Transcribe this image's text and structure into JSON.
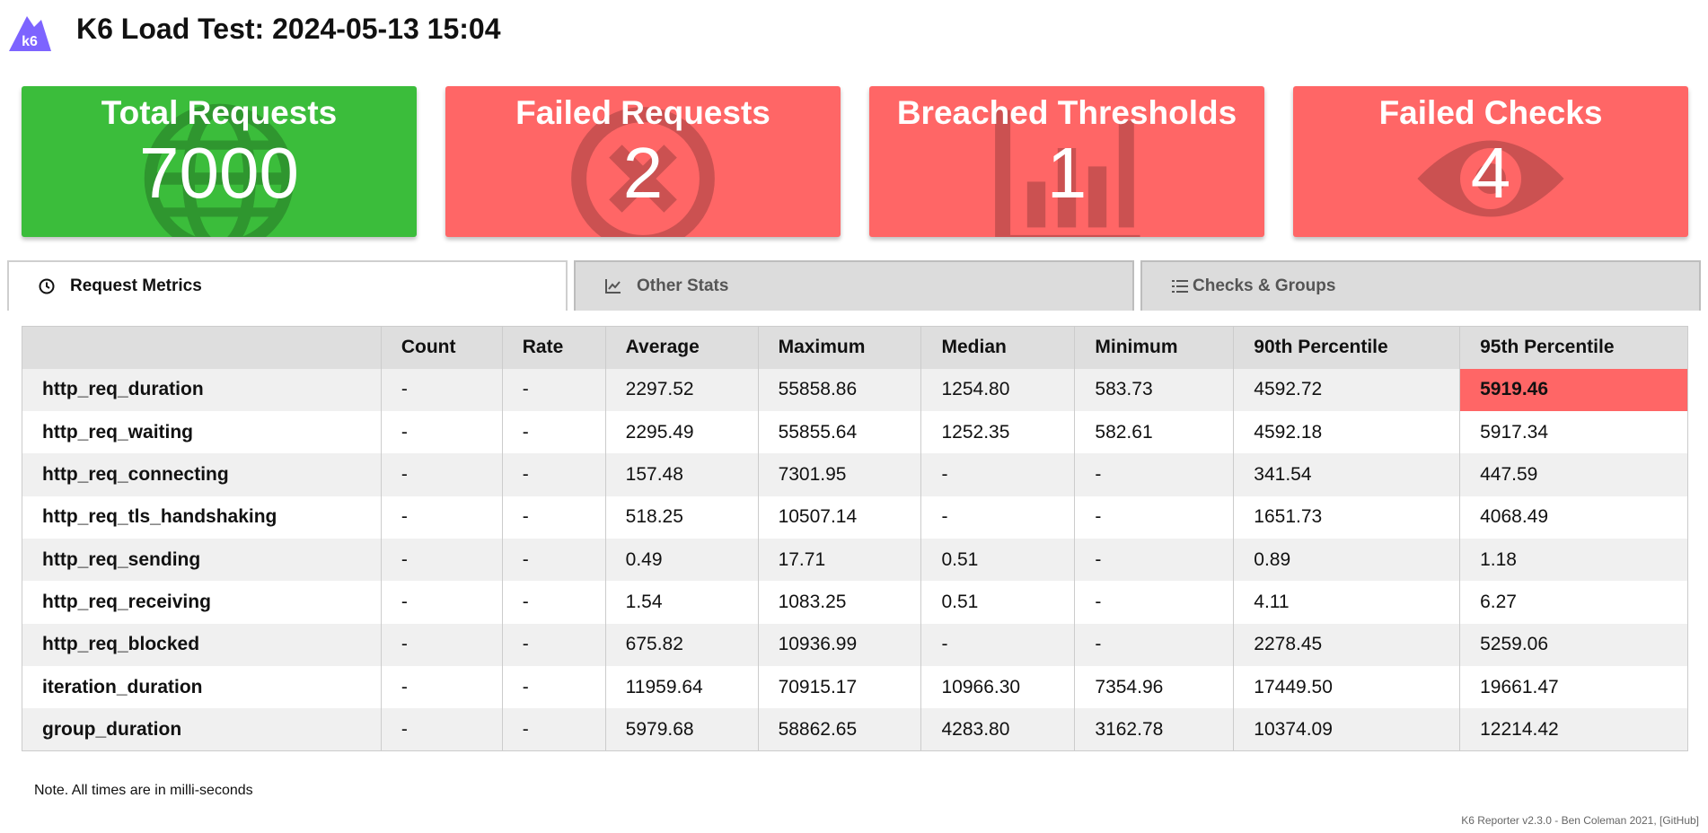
{
  "header": {
    "title": "K6 Load Test: 2024-05-13 15:04",
    "logo_text": "k6",
    "logo_color": "#7d64ff"
  },
  "cards": [
    {
      "title": "Total Requests",
      "value": "7000",
      "color": "#3bbd3b",
      "icon": "globe-icon"
    },
    {
      "title": "Failed Requests",
      "value": "2",
      "color": "#ff6666",
      "icon": "circle-x-icon"
    },
    {
      "title": "Breached Thresholds",
      "value": "1",
      "color": "#ff6666",
      "icon": "bar-chart-icon"
    },
    {
      "title": "Failed Checks",
      "value": "4",
      "color": "#ff6666",
      "icon": "eye-icon"
    }
  ],
  "tabs": [
    {
      "label": "Request Metrics",
      "icon": "clock-icon",
      "active": true
    },
    {
      "label": "Other Stats",
      "icon": "line-chart-icon",
      "active": false
    },
    {
      "label": "Checks & Groups",
      "icon": "list-icon",
      "active": false
    }
  ],
  "table": {
    "headers": [
      "",
      "Count",
      "Rate",
      "Average",
      "Maximum",
      "Median",
      "Minimum",
      "90th Percentile",
      "95th Percentile"
    ],
    "rows": [
      [
        "http_req_duration",
        "-",
        "-",
        "2297.52",
        "55858.86",
        "1254.80",
        "583.73",
        "4592.72",
        "5919.46"
      ],
      [
        "http_req_waiting",
        "-",
        "-",
        "2295.49",
        "55855.64",
        "1252.35",
        "582.61",
        "4592.18",
        "5917.34"
      ],
      [
        "http_req_connecting",
        "-",
        "-",
        "157.48",
        "7301.95",
        "-",
        "-",
        "341.54",
        "447.59"
      ],
      [
        "http_req_tls_handshaking",
        "-",
        "-",
        "518.25",
        "10507.14",
        "-",
        "-",
        "1651.73",
        "4068.49"
      ],
      [
        "http_req_sending",
        "-",
        "-",
        "0.49",
        "17.71",
        "0.51",
        "-",
        "0.89",
        "1.18"
      ],
      [
        "http_req_receiving",
        "-",
        "-",
        "1.54",
        "1083.25",
        "0.51",
        "-",
        "4.11",
        "6.27"
      ],
      [
        "http_req_blocked",
        "-",
        "-",
        "675.82",
        "10936.99",
        "-",
        "-",
        "2278.45",
        "5259.06"
      ],
      [
        "iteration_duration",
        "-",
        "-",
        "11959.64",
        "70915.17",
        "10966.30",
        "7354.96",
        "17449.50",
        "19661.47"
      ],
      [
        "group_duration",
        "-",
        "-",
        "5979.68",
        "58862.65",
        "4283.80",
        "3162.78",
        "10374.09",
        "12214.42"
      ]
    ],
    "breach_color": "#ff6666"
  },
  "note": "Note. All times are in milli-seconds",
  "footer": "K6 Reporter v2.3.0 - Ben Coleman 2021, [GitHub]"
}
